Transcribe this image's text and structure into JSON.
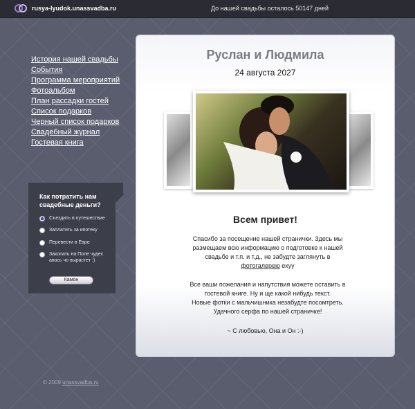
{
  "topbar": {
    "site_name": "rusya-lyudok.unassvadba.ru",
    "countdown": "До нашей свадьбы осталось 50147 дней"
  },
  "nav": [
    "История нашей свадьбы",
    "События",
    "Программа мероприятий",
    "Фотоальбом",
    "План рассадки гостей",
    "Список подарков",
    "Черный список подарков",
    "Свадебный журнал",
    "Гостевая книга"
  ],
  "poll": {
    "title": "Как потратить нам свадебные деньги?",
    "options": [
      "Съездить в путешествие",
      "Заплатить за ипотеку",
      "Перевести в Евро",
      "Закопать на Поле чудес авось чо вырастет :)"
    ],
    "selected_index": 0,
    "button": "Камон"
  },
  "card": {
    "couple": "Руслан и Людмила",
    "date": "24 августа  2027",
    "hello": "Всем привет!",
    "para1_lines": [
      "Спасибо за посещение нашей странички.  Здесь мы",
      "размещаем всю информацию о подготовке к нашей",
      "свадьбе и т.п. и т.д.,  не забудте заглянуть в"
    ],
    "para1_link": "фотогалерею",
    "para1_tail": " ехуу",
    "para2_lines": [
      "Все ваши пожелания и напутствия можете оставить в",
      "гостевой книге. Ну и ще какой нибудь текст.",
      "Новые фотки с мальчишника незабудте  посомтреть.",
      "Удачного серфа по нашей страничке!"
    ],
    "signature": "~ С любовью, Она и Он :-)"
  },
  "footer": {
    "prefix": "© 2009 ",
    "link": "unassvadba.ru"
  }
}
